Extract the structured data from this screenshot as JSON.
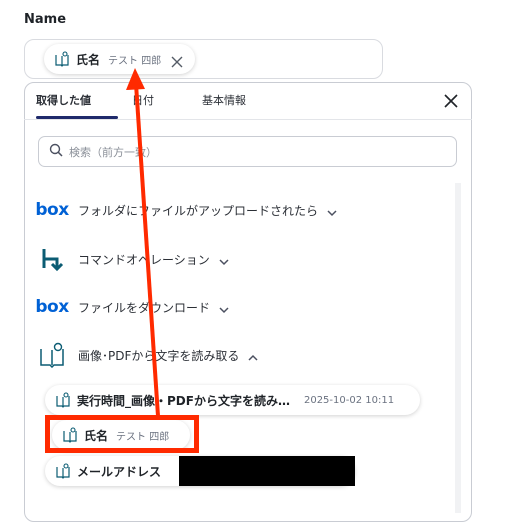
{
  "field": {
    "label": "Name"
  },
  "selected_chip": {
    "label": "氏名",
    "value": "テスト 四郎"
  },
  "tabs": [
    {
      "label": "取得した値",
      "active": true
    },
    {
      "label": "日付",
      "active": false
    },
    {
      "label": "基本情報",
      "active": false
    }
  ],
  "search": {
    "placeholder": "検索（前方一致）"
  },
  "sources": [
    {
      "label": "フォルダにファイルがアップロードされたら",
      "icon": "box-logo-icon",
      "expanded": false
    },
    {
      "label": "コマンドオペレーション",
      "icon": "command-operation-icon",
      "expanded": false
    },
    {
      "label": "ファイルをダウンロード",
      "icon": "box-logo-icon",
      "expanded": false
    },
    {
      "label": "画像･PDFから文字を読み取る",
      "icon": "ocr-book-icon",
      "expanded": true
    }
  ],
  "ocr_items": [
    {
      "label": "実行時間_画像・PDFから文字を読み…",
      "value": "2025-10-02 10:11"
    },
    {
      "label": "氏名",
      "value": "テスト 四郎"
    },
    {
      "label": "メールアドレス",
      "value": ""
    }
  ],
  "brand": {
    "box": "box"
  },
  "colors": {
    "highlight": "#ff2a00",
    "tab_underline": "#1f2a6b",
    "box_blue": "#0061d5",
    "command_teal": "#0b5c73"
  }
}
